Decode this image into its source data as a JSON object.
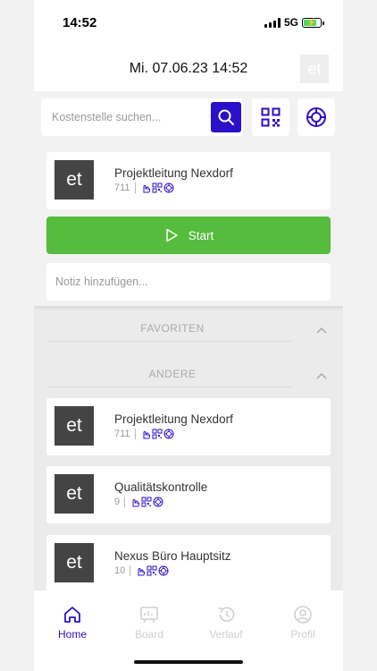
{
  "status": {
    "time": "14:52",
    "network": "5G"
  },
  "header": {
    "title": "Mi. 07.06.23 14:52",
    "avatar_text": "et"
  },
  "search": {
    "placeholder": "Kostenstelle suchen...",
    "value": ""
  },
  "selected": {
    "logo_text": "et",
    "name": "Projektleitung Nexdorf",
    "number": "711"
  },
  "start": {
    "label": "Start"
  },
  "note": {
    "placeholder": "Notiz hinzufügen..."
  },
  "sections": {
    "favorites": {
      "title": "FAVORITEN"
    },
    "other": {
      "title": "ANDERE"
    }
  },
  "list": [
    {
      "logo_text": "et",
      "name": "Projektleitung Nexdorf",
      "number": "711"
    },
    {
      "logo_text": "et",
      "name": "Qualitätskontrolle",
      "number": "9"
    },
    {
      "logo_text": "et",
      "name": "Nexus Büro Hauptsitz",
      "number": "10"
    }
  ],
  "tabs": [
    {
      "label": "Home",
      "icon": "home-icon",
      "active": true
    },
    {
      "label": "Board",
      "icon": "board-icon",
      "active": false
    },
    {
      "label": "Verlauf",
      "icon": "history-icon",
      "active": false
    },
    {
      "label": "Profil",
      "icon": "profile-icon",
      "active": false
    }
  ],
  "colors": {
    "accent": "#2a10c9",
    "start_green": "#55bc3d",
    "inactive": "#d0d0d0"
  }
}
